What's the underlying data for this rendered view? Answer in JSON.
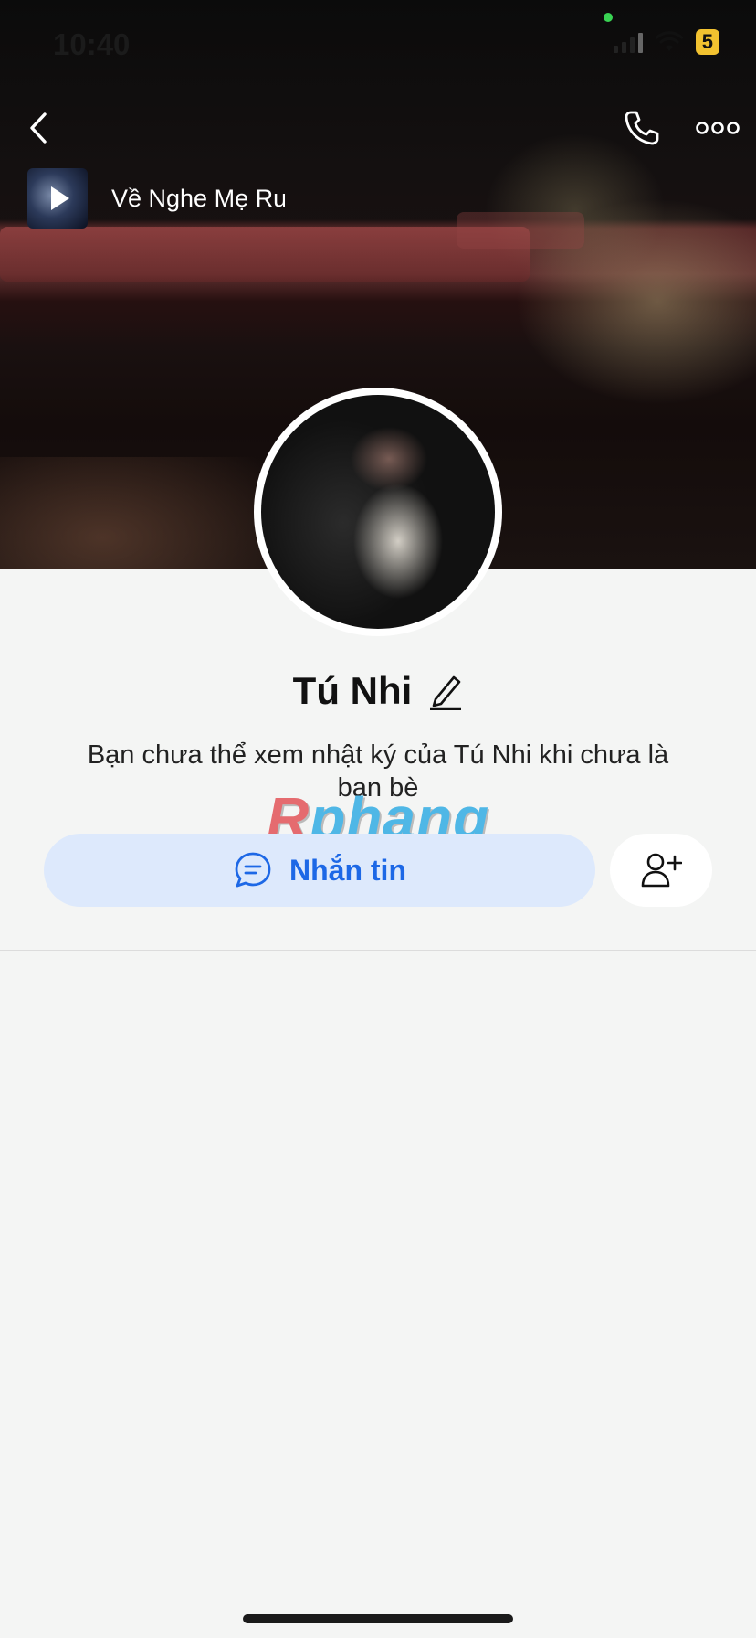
{
  "status_bar": {
    "time": "10:40",
    "battery": "5"
  },
  "music": {
    "title": "Về Nghe Mẹ Ru"
  },
  "profile": {
    "name": "Tú Nhi",
    "description": "Bạn chưa thể xem nhật ký của Tú Nhi khi chưa là bạn bè"
  },
  "actions": {
    "message_label": "Nhắn tin"
  },
  "watermark": {
    "first": "R",
    "rest": "phang"
  },
  "icons": {
    "back": "chevron-left-icon",
    "call": "phone-icon",
    "more": "more-dots-icon",
    "edit": "pencil-icon",
    "chat": "chat-bubble-icon",
    "add_friend": "add-friend-icon",
    "play": "play-icon"
  },
  "colors": {
    "accent": "#1d68e6",
    "button_bg": "#dde9fc",
    "battery": "#f2c230"
  }
}
